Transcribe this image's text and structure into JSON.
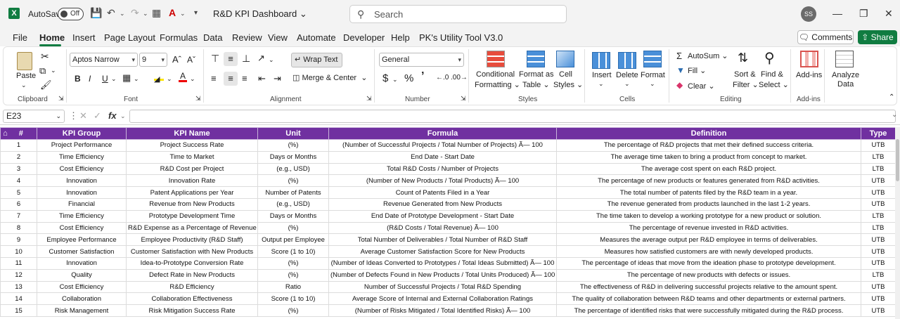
{
  "titlebar": {
    "autosave_label": "AutoSave",
    "autosave_state": "Off",
    "doc_title": "R&D KPI Dashboard",
    "search_placeholder": "Search",
    "user_initials": "SS"
  },
  "menu": {
    "items": [
      "File",
      "Home",
      "Insert",
      "Page Layout",
      "Formulas",
      "Data",
      "Review",
      "View",
      "Automate",
      "Developer",
      "Help",
      "PK's Utility Tool V3.0"
    ],
    "active": "Home",
    "comments_label": "Comments",
    "share_label": "Share"
  },
  "ribbon": {
    "clipboard": {
      "paste": "Paste",
      "group": "Clipboard"
    },
    "font": {
      "name": "Aptos Narrow",
      "size": "9",
      "group": "Font"
    },
    "alignment": {
      "wrap": "Wrap Text",
      "merge": "Merge & Center",
      "group": "Alignment"
    },
    "number": {
      "format": "General",
      "group": "Number"
    },
    "styles": {
      "conditional": "Conditional",
      "formatting": "Formatting",
      "format_as": "Format as",
      "table": "Table",
      "cell": "Cell",
      "styles": "Styles",
      "group": "Styles"
    },
    "cells": {
      "insert": "Insert",
      "delete": "Delete",
      "format": "Format",
      "group": "Cells"
    },
    "editing": {
      "autosum": "AutoSum",
      "fill": "Fill",
      "clear": "Clear",
      "sort": "Sort &",
      "filter": "Filter",
      "find": "Find &",
      "select": "Select",
      "group": "Editing"
    },
    "addins": {
      "label": "Add-ins",
      "group": "Add-ins"
    },
    "analyze": {
      "line1": "Analyze",
      "line2": "Data"
    }
  },
  "formula_bar": {
    "cell_ref": "E23",
    "fx": "fx"
  },
  "table": {
    "headers": [
      "#",
      "KPI Group",
      "KPI Name",
      "Unit",
      "Formula",
      "Definition",
      "Type"
    ],
    "rows": [
      [
        "1",
        "Project Performance",
        "Project Success Rate",
        "(%)",
        "(Number of Successful Projects / Total Number of Projects) Ã— 100",
        "The percentage of R&D projects that met their defined success criteria.",
        "UTB"
      ],
      [
        "2",
        "Time Efficiency",
        "Time to Market",
        "Days or Months",
        "End Date - Start Date",
        "The average time taken to bring a product from concept to market.",
        "LTB"
      ],
      [
        "3",
        "Cost Efficiency",
        "R&D Cost per Project",
        "(e.g., USD)",
        "Total R&D Costs / Number of Projects",
        "The average cost spent on each R&D project.",
        "LTB"
      ],
      [
        "4",
        "Innovation",
        "Innovation Rate",
        "(%)",
        "(Number of New Products / Total Products) Ã— 100",
        "The percentage of new products or features generated from R&D activities.",
        "UTB"
      ],
      [
        "5",
        "Innovation",
        "Patent Applications per Year",
        "Number of Patents",
        "Count of Patents Filed in a Year",
        "The total number of patents filed by the R&D team in a year.",
        "UTB"
      ],
      [
        "6",
        "Financial",
        "Revenue from New Products",
        "(e.g., USD)",
        "Revenue Generated from New Products",
        "The revenue generated from products launched in the last 1-2 years.",
        "UTB"
      ],
      [
        "7",
        "Time Efficiency",
        "Prototype Development Time",
        "Days or Months",
        "End Date of Prototype Development - Start Date",
        "The time taken to develop a working prototype for a new product or solution.",
        "LTB"
      ],
      [
        "8",
        "Cost Efficiency",
        "R&D Expense as a Percentage of Revenue",
        "(%)",
        "(R&D Costs / Total Revenue) Ã— 100",
        "The percentage of revenue invested in R&D activities.",
        "LTB"
      ],
      [
        "9",
        "Employee Performance",
        "Employee Productivity (R&D Staff)",
        "Output per Employee",
        "Total Number of Deliverables / Total Number of R&D Staff",
        "Measures the average output per R&D employee in terms of deliverables.",
        "UTB"
      ],
      [
        "10",
        "Customer Satisfaction",
        "Customer Satisfaction with New Products",
        "Score (1 to 10)",
        "Average Customer Satisfaction Score for New Products",
        "Measures how satisfied customers are with newly developed products.",
        "UTB"
      ],
      [
        "11",
        "Innovation",
        "Idea-to-Prototype Conversion Rate",
        "(%)",
        "(Number of Ideas Converted to Prototypes / Total Ideas Submitted) Ã— 100",
        "The percentage of ideas that move from the ideation phase to prototype development.",
        "UTB"
      ],
      [
        "12",
        "Quality",
        "Defect Rate in New Products",
        "(%)",
        "(Number of Defects Found in New Products / Total Units Produced) Ã— 100",
        "The percentage of new products with defects or issues.",
        "LTB"
      ],
      [
        "13",
        "Cost Efficiency",
        "R&D Efficiency",
        "Ratio",
        "Number of Successful Projects / Total R&D Spending",
        "The effectiveness of R&D in delivering successful projects relative to the amount spent.",
        "UTB"
      ],
      [
        "14",
        "Collaboration",
        "Collaboration Effectiveness",
        "Score (1 to 10)",
        "Average Score of Internal and External Collaboration Ratings",
        "The quality of collaboration between R&D teams and other departments or external partners.",
        "UTB"
      ],
      [
        "15",
        "Risk Management",
        "Risk Mitigation Success Rate",
        "(%)",
        "(Number of Risks Mitigated / Total Identified Risks) Ã— 100",
        "The percentage of identified risks that were successfully mitigated during the R&D process.",
        "UTB"
      ]
    ]
  },
  "colors": {
    "header_bg": "#7030a0",
    "accent": "#107c41"
  }
}
